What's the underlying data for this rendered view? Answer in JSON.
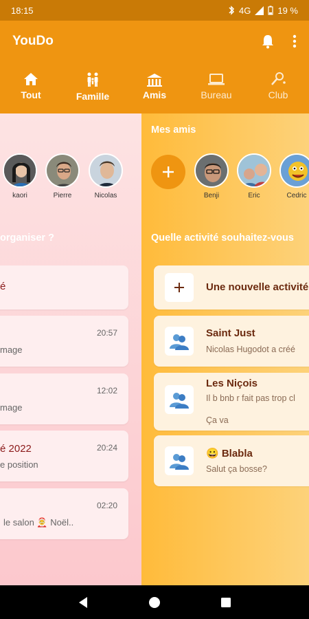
{
  "status": {
    "time": "18:15",
    "network": "4G",
    "battery": "19 %"
  },
  "app": {
    "title": "YouDo"
  },
  "tabs": [
    {
      "label": "Tout",
      "icon": "home-icon"
    },
    {
      "label": "Famille",
      "icon": "family-icon"
    },
    {
      "label": "Amis",
      "icon": "people-icon"
    },
    {
      "label": "Bureau",
      "icon": "laptop-icon"
    },
    {
      "label": "Club",
      "icon": "club-icon"
    }
  ],
  "left": {
    "contacts": [
      {
        "name": "kaori"
      },
      {
        "name": "Pierre"
      },
      {
        "name": "Nicolas"
      }
    ],
    "section_title": "organiser ?",
    "cards": [
      {
        "title": "é",
        "time": "",
        "text": ""
      },
      {
        "title": "",
        "time": "20:57",
        "text": "mage"
      },
      {
        "title": "",
        "time": "12:02",
        "text": "mage"
      },
      {
        "title": "é 2022",
        "time": "20:24",
        "text": "e position"
      },
      {
        "title": "",
        "time": "02:20",
        "text": "le salon 🤶 Noël.."
      }
    ]
  },
  "right": {
    "friends_title": "Mes amis",
    "friends": [
      {
        "name": "Benji"
      },
      {
        "name": "Eric"
      },
      {
        "name": "Cedric"
      }
    ],
    "activity_title": "Quelle activité souhaitez-vous",
    "new_activity": "Une nouvelle activité",
    "activities": [
      {
        "title": "Saint Just",
        "sub": "Nicolas Hugodot a créé",
        "sub2": ""
      },
      {
        "title": "Les Niçois",
        "sub": "Il b bnb r fait pas trop cl",
        "sub2": "Ça va"
      },
      {
        "title": "😀 Blabla",
        "sub": "Salut ça bosse?",
        "sub2": ""
      }
    ]
  },
  "colors": {
    "primary": "#EF9511",
    "status": "#C97A06",
    "title_red": "#8B1A1A"
  }
}
